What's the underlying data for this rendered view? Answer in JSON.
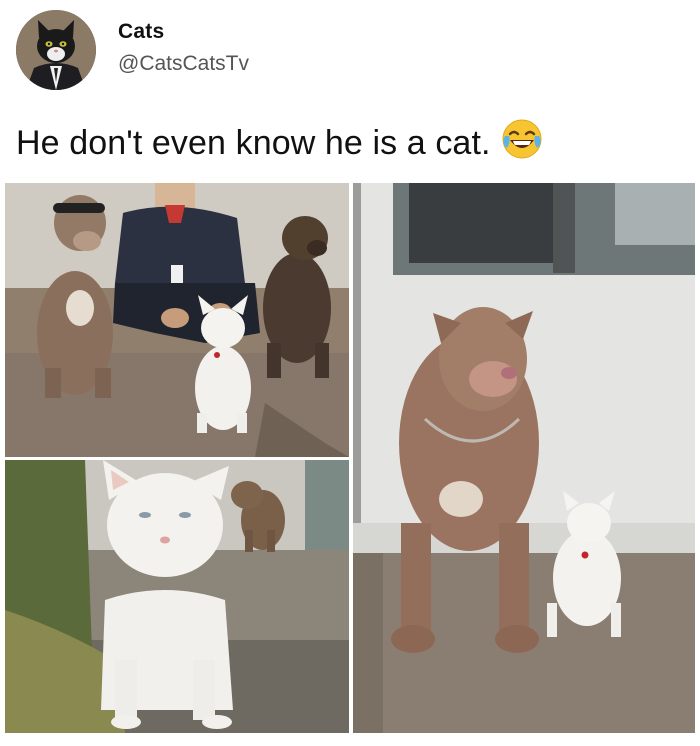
{
  "tweet": {
    "display_name": "Cats",
    "handle": "@CatsCatsTv",
    "text": "He don't even know he is a cat.",
    "emoji": "face-with-tears-of-joy"
  },
  "media": {
    "count": 3,
    "photos": [
      {
        "subject": "two pit bulls, a man and a white cat"
      },
      {
        "subject": "white cat close-up with dog behind"
      },
      {
        "subject": "pit bull and white cat standing together"
      }
    ]
  },
  "colors": {
    "text": "#111111",
    "handle": "#555555",
    "background": "#ffffff"
  }
}
